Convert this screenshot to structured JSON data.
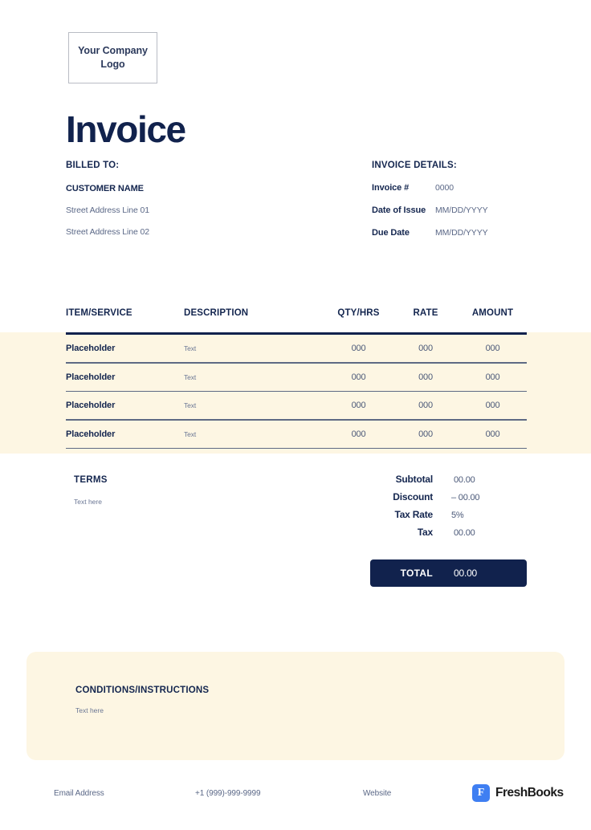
{
  "document": {
    "title": "Invoice",
    "logo_placeholder": "Your Company Logo"
  },
  "billed_to": {
    "label": "BILLED TO:",
    "customer_name": "CUSTOMER NAME",
    "address_line_1": "Street Address Line 01",
    "address_line_2": "Street Address Line 02"
  },
  "invoice_details": {
    "label": "INVOICE DETAILS:",
    "rows": [
      {
        "key": "Invoice #",
        "value": "0000"
      },
      {
        "key": "Date of Issue",
        "value": "MM/DD/YYYY"
      },
      {
        "key": "Due Date",
        "value": "MM/DD/YYYY"
      }
    ]
  },
  "table": {
    "columns": [
      "ITEM/SERVICE",
      "DESCRIPTION",
      "QTY/HRS",
      "RATE",
      "AMOUNT"
    ],
    "rows": [
      {
        "item": "Placeholder",
        "description": "Text",
        "qty": "000",
        "rate": "000",
        "amount": "000"
      },
      {
        "item": "Placeholder",
        "description": "Text",
        "qty": "000",
        "rate": "000",
        "amount": "000"
      },
      {
        "item": "Placeholder",
        "description": "Text",
        "qty": "000",
        "rate": "000",
        "amount": "000"
      },
      {
        "item": "Placeholder",
        "description": "Text",
        "qty": "000",
        "rate": "000",
        "amount": "000"
      }
    ]
  },
  "terms": {
    "title": "TERMS",
    "body": "Text here"
  },
  "totals": {
    "rows": [
      {
        "label": "Subtotal",
        "value": "00.00"
      },
      {
        "label": "Discount",
        "value": "– 00.00"
      },
      {
        "label": "Tax Rate",
        "value": "5%"
      },
      {
        "label": "Tax",
        "value": "00.00"
      }
    ],
    "total_label": "TOTAL",
    "total_value": "00.00"
  },
  "conditions": {
    "title": "CONDITIONS/INSTRUCTIONS",
    "body": "Text here"
  },
  "footer": {
    "email": "Email Address",
    "phone": "+1 (999)-999-9999",
    "website": "Website",
    "brand_name": "FreshBooks",
    "brand_mark_letter": "F"
  },
  "colors": {
    "navy": "#11224d",
    "navy_text": "#14264f",
    "muted": "#5b6887",
    "cream": "#fdf6e3",
    "brand_blue": "#3f7ff2"
  }
}
